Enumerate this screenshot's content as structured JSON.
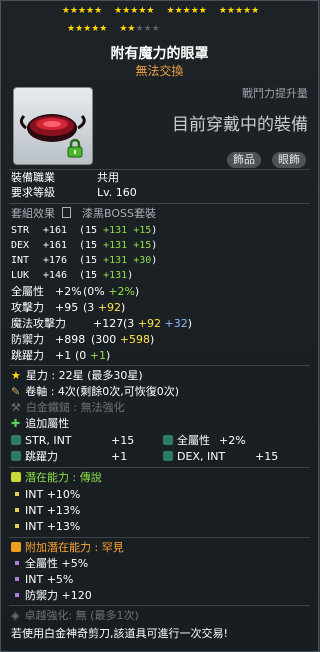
{
  "stars": {
    "filled": 22,
    "max": 30,
    "row1": [
      "★★★★★",
      "★★★★★",
      "★★★★★",
      "★★★★★"
    ],
    "row2": [
      {
        "on": "★★★★★",
        "off": ""
      },
      {
        "on": "★★",
        "off": "★★★"
      }
    ]
  },
  "item": {
    "name": "附有魔力的眼罩",
    "trade": "無法交換"
  },
  "power_label": "戰鬥力提升量",
  "current_equip": "目前穿戴中的裝備",
  "tags": [
    "飾品",
    "眼飾"
  ],
  "basic": {
    "job_label": "裝備職業",
    "job_value": "共用",
    "req_label": "要求等級",
    "req_value": "Lv. 160"
  },
  "set": {
    "label": "套組效果",
    "value": "漆黑BOSS套裝"
  },
  "stats": [
    {
      "name": "STR",
      "total": "+161",
      "base": "15",
      "p1": "+131",
      "p2": "+15"
    },
    {
      "name": "DEX",
      "total": "+161",
      "base": "15",
      "p1": "+131",
      "p2": "+15"
    },
    {
      "name": "INT",
      "total": "+176",
      "base": "15",
      "p1": "+131",
      "p2": "+30"
    },
    {
      "name": "LUK",
      "total": "+146",
      "base": "15",
      "p1": "+131",
      "p2": ""
    }
  ],
  "all_stat": {
    "name": "全屬性",
    "total": "+2%",
    "base": "0%",
    "p1": "+2%"
  },
  "attack": {
    "name": "攻擊力",
    "total": "+95",
    "base": "3",
    "p1": "+92"
  },
  "magic_attack": {
    "name": "魔法攻擊力",
    "total": "+127",
    "base": "3",
    "p1": "+92",
    "p2": "+32"
  },
  "defense": {
    "name": "防禦力",
    "total": "+898",
    "base": "300",
    "p1": "+598"
  },
  "jump": {
    "name": "跳躍力",
    "total": "+1",
    "base": "0",
    "p1": "+1"
  },
  "starforce": "星力 : 22星 (最多30星)",
  "scroll": "卷軸 : 4次(剩餘0次,可恢復0次)",
  "hammer": "白金鐵鎚 : 無法強化",
  "bonus": {
    "title": "追加屬性",
    "items": [
      [
        "STR, INT",
        "+15"
      ],
      [
        "全屬性",
        "+2%"
      ],
      [
        "跳躍力",
        "+1"
      ],
      [
        "DEX, INT",
        "+15"
      ]
    ]
  },
  "potential": {
    "title": "潛在能力 : ",
    "grade": "傳說",
    "lines": [
      "INT +10%",
      "INT +13%",
      "INT +13%"
    ]
  },
  "addi_potential": {
    "title": "附加潛在能力 : ",
    "grade": "罕見",
    "lines": [
      "全屬性 +5%",
      "INT +5%",
      "防禦力 +120"
    ]
  },
  "exceptional": "卓越強化: 無 (最多1次)",
  "footer": "若使用白金神奇剪刀,該道具可進行一次交易!"
}
